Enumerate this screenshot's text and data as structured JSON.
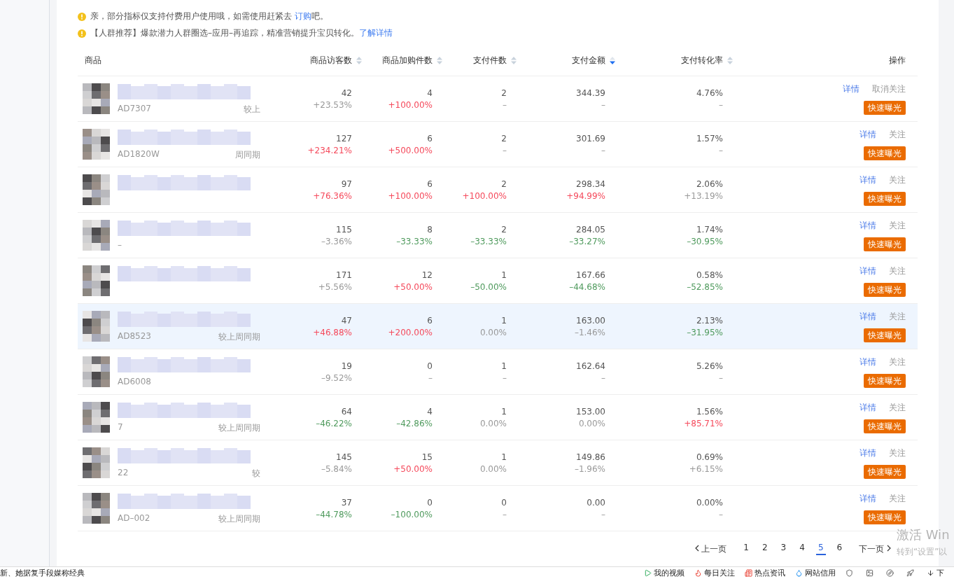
{
  "notices": [
    {
      "before": "亲，部分指标仅支持付费用户使用哦，如需使用赶紧去 ",
      "link": "订购",
      "after": "吧。"
    },
    {
      "before": "【人群推荐】爆款潜力人群圈选–应用–再追踪，精准营销提升宝贝转化。",
      "link": "了解详情"
    }
  ],
  "columns": [
    {
      "label": "商品",
      "kind": "product"
    },
    {
      "label": "商品访客数",
      "sorted": false,
      "kind": "metric"
    },
    {
      "label": "商品加购件数",
      "sorted": false,
      "kind": "metric"
    },
    {
      "label": "支付件数",
      "sorted": false,
      "kind": "metric"
    },
    {
      "label": "支付金额",
      "sorted": true,
      "kind": "metric"
    },
    {
      "label": "支付转化率",
      "sorted": false,
      "kind": "metric"
    },
    {
      "label": "操作",
      "kind": "actions"
    }
  ],
  "rows": [
    {
      "highlighted": false,
      "sku": "AD7307",
      "compare": "较上",
      "metrics": [
        {
          "value": "42",
          "change": "+23.53%",
          "color": "#999999"
        },
        {
          "value": "4",
          "change": "+100.00%",
          "color": "#f5495b"
        },
        {
          "value": "2",
          "change": "–",
          "color": "#999999"
        },
        {
          "value": "344.39",
          "change": "–",
          "color": "#999999"
        },
        {
          "value": "4.76%",
          "change": "–",
          "color": "#999999"
        }
      ],
      "detail": "详情",
      "follow": "取消关注",
      "boost": "快速曝光"
    },
    {
      "highlighted": false,
      "sku": "AD1820W",
      "compare": "周同期",
      "metrics": [
        {
          "value": "127",
          "change": "+234.21%",
          "color": "#f5495b"
        },
        {
          "value": "6",
          "change": "+500.00%",
          "color": "#f5495b"
        },
        {
          "value": "2",
          "change": "–",
          "color": "#999999"
        },
        {
          "value": "301.69",
          "change": "–",
          "color": "#999999"
        },
        {
          "value": "1.57%",
          "change": "–",
          "color": "#999999"
        }
      ],
      "detail": "详情",
      "follow": "关注",
      "boost": "快速曝光"
    },
    {
      "highlighted": false,
      "metrics": [
        {
          "value": "97",
          "change": "+76.36%",
          "color": "#f5495b"
        },
        {
          "value": "6",
          "change": "+100.00%",
          "color": "#f5495b"
        },
        {
          "value": "2",
          "change": "+100.00%",
          "color": "#f5495b"
        },
        {
          "value": "298.34",
          "change": "+94.99%",
          "color": "#f5495b"
        },
        {
          "value": "2.06%",
          "change": "+13.19%",
          "color": "#999999"
        }
      ],
      "detail": "详情",
      "follow": "关注",
      "boost": "快速曝光"
    },
    {
      "highlighted": false,
      "sku": "–",
      "metrics": [
        {
          "value": "115",
          "change": "–3.36%",
          "color": "#999999"
        },
        {
          "value": "8",
          "change": "–33.33%",
          "color": "#4f9a5d"
        },
        {
          "value": "2",
          "change": "–33.33%",
          "color": "#4f9a5d"
        },
        {
          "value": "284.05",
          "change": "–33.27%",
          "color": "#4f9a5d"
        },
        {
          "value": "1.74%",
          "change": "–30.95%",
          "color": "#4f9a5d"
        }
      ],
      "detail": "详情",
      "follow": "关注",
      "boost": "快速曝光"
    },
    {
      "highlighted": false,
      "metrics": [
        {
          "value": "171",
          "change": "+5.56%",
          "color": "#999999"
        },
        {
          "value": "12",
          "change": "+50.00%",
          "color": "#f5495b"
        },
        {
          "value": "1",
          "change": "–50.00%",
          "color": "#4f9a5d"
        },
        {
          "value": "167.66",
          "change": "–44.68%",
          "color": "#4f9a5d"
        },
        {
          "value": "0.58%",
          "change": "–52.85%",
          "color": "#4f9a5d"
        }
      ],
      "detail": "详情",
      "follow": "关注",
      "boost": "快速曝光"
    },
    {
      "highlighted": true,
      "sku": "AD8523",
      "compare": "较上周同期",
      "metrics": [
        {
          "value": "47",
          "change": "+46.88%",
          "color": "#f5495b"
        },
        {
          "value": "6",
          "change": "+200.00%",
          "color": "#f5495b"
        },
        {
          "value": "1",
          "change": "0.00%",
          "color": "#999999"
        },
        {
          "value": "163.00",
          "change": "–1.46%",
          "color": "#999999"
        },
        {
          "value": "2.13%",
          "change": "–31.95%",
          "color": "#4f9a5d"
        }
      ],
      "detail": "详情",
      "follow": "关注",
      "boost": "快速曝光"
    },
    {
      "highlighted": false,
      "sku": "AD6008",
      "metrics": [
        {
          "value": "19",
          "change": "–9.52%",
          "color": "#999999"
        },
        {
          "value": "0",
          "change": "–",
          "color": "#999999"
        },
        {
          "value": "1",
          "change": "–",
          "color": "#999999"
        },
        {
          "value": "162.64",
          "change": "–",
          "color": "#999999"
        },
        {
          "value": "5.26%",
          "change": "–",
          "color": "#999999"
        }
      ],
      "detail": "详情",
      "follow": "关注",
      "boost": "快速曝光"
    },
    {
      "highlighted": false,
      "sku": "7",
      "compare": "较上周同期",
      "metrics": [
        {
          "value": "64",
          "change": "–46.22%",
          "color": "#4f9a5d"
        },
        {
          "value": "4",
          "change": "–42.86%",
          "color": "#4f9a5d"
        },
        {
          "value": "1",
          "change": "0.00%",
          "color": "#999999"
        },
        {
          "value": "153.00",
          "change": "0.00%",
          "color": "#999999"
        },
        {
          "value": "1.56%",
          "change": "+85.71%",
          "color": "#f5495b"
        }
      ],
      "detail": "详情",
      "follow": "关注",
      "boost": "快速曝光"
    },
    {
      "highlighted": false,
      "sku": "22",
      "compare": "较",
      "metrics": [
        {
          "value": "145",
          "change": "–5.84%",
          "color": "#999999"
        },
        {
          "value": "15",
          "change": "+50.00%",
          "color": "#f5495b"
        },
        {
          "value": "1",
          "change": "0.00%",
          "color": "#999999"
        },
        {
          "value": "149.86",
          "change": "–1.96%",
          "color": "#999999"
        },
        {
          "value": "0.69%",
          "change": "+6.15%",
          "color": "#999999"
        }
      ],
      "detail": "详情",
      "follow": "关注",
      "boost": "快速曝光"
    },
    {
      "highlighted": false,
      "sku": "AD–002",
      "compare": "较上周同期",
      "metrics": [
        {
          "value": "37",
          "change": "–44.78%",
          "color": "#4f9a5d"
        },
        {
          "value": "0",
          "change": "–100.00%",
          "color": "#4f9a5d"
        },
        {
          "value": "0",
          "change": "–",
          "color": "#999999"
        },
        {
          "value": "0.00",
          "change": "–",
          "color": "#999999"
        },
        {
          "value": "0.00%",
          "change": "–",
          "color": "#999999"
        }
      ],
      "detail": "详情",
      "follow": "关注",
      "boost": "快速曝光"
    }
  ],
  "pagination": {
    "prev": "上一页",
    "next": "下一页",
    "pages": [
      {
        "label": "1",
        "selected": false
      },
      {
        "label": "2",
        "selected": false
      },
      {
        "label": "3",
        "selected": false
      },
      {
        "label": "4",
        "selected": false
      },
      {
        "label": "5",
        "selected": true
      },
      {
        "label": "6",
        "selected": false
      }
    ]
  },
  "os_overlay": {
    "title": "激活 Win",
    "hint": "转到“设置”以"
  },
  "status_bar": {
    "news": "新、她据复手段媒称经典",
    "items": [
      {
        "kind": "video",
        "label": "我的视频"
      },
      {
        "kind": "fire",
        "label": "每日关注"
      },
      {
        "kind": "news",
        "label": "热点资讯"
      },
      {
        "kind": "drop",
        "label": "网站信用"
      }
    ],
    "download": "下"
  }
}
